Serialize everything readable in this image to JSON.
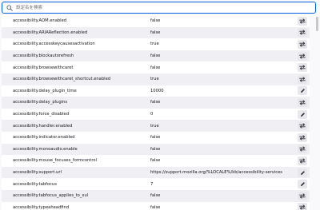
{
  "search": {
    "placeholder": "設定名を検索",
    "value": ""
  },
  "icons": {
    "search": "search-icon",
    "toggle": "toggle-icon",
    "edit": "pencil-icon"
  },
  "colors": {
    "accent": "#0061e0",
    "row_alt": "#f0f0f4"
  },
  "preferences": [
    {
      "name": "accessibility.AOM.enabled",
      "value": "false",
      "action": "toggle"
    },
    {
      "name": "accessibility.ARIAReflection.enabled",
      "value": "false",
      "action": "toggle"
    },
    {
      "name": "accessibility.accesskeycausesactivation",
      "value": "true",
      "action": "toggle"
    },
    {
      "name": "accessibility.blockautorefresh",
      "value": "false",
      "action": "toggle"
    },
    {
      "name": "accessibility.browsewithcaret",
      "value": "false",
      "action": "toggle"
    },
    {
      "name": "accessibility.browsewithcaret_shortcut.enabled",
      "value": "true",
      "action": "toggle"
    },
    {
      "name": "accessibility.delay_plugin_time",
      "value": "10000",
      "action": "edit"
    },
    {
      "name": "accessibility.delay_plugins",
      "value": "false",
      "action": "toggle"
    },
    {
      "name": "accessibility.force_disabled",
      "value": "0",
      "action": "edit"
    },
    {
      "name": "accessibility.handler.enabled",
      "value": "true",
      "action": "toggle"
    },
    {
      "name": "accessibility.indicator.enabled",
      "value": "false",
      "action": "toggle"
    },
    {
      "name": "accessibility.monoaudio.enable",
      "value": "false",
      "action": "toggle"
    },
    {
      "name": "accessibility.mouse_focuses_formcontrol",
      "value": "false",
      "action": "toggle"
    },
    {
      "name": "accessibility.support.url",
      "value": "https://support.mozilla.org/%LOCALE%/kb/accessibility-services",
      "action": "edit"
    },
    {
      "name": "accessibility.tabfocus",
      "value": "7",
      "action": "edit"
    },
    {
      "name": "accessibility.tabfocus_applies_to_xul",
      "value": "false",
      "action": "toggle"
    },
    {
      "name": "accessibility.typeaheadfind",
      "value": "false",
      "action": "toggle"
    }
  ]
}
